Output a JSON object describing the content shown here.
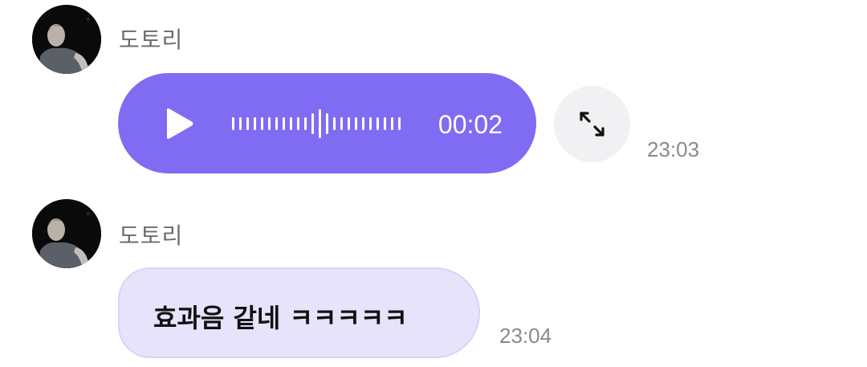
{
  "messages": [
    {
      "sender": "도토리",
      "type": "voice",
      "duration": "00:02",
      "time": "23:03",
      "icons": {
        "play": "play-icon",
        "expand": "expand-icon"
      }
    },
    {
      "sender": "도토리",
      "type": "text",
      "text": "효과음 같네 ㅋㅋㅋㅋㅋ",
      "time": "23:04"
    }
  ],
  "colors": {
    "voice_bubble": "#7f6cf3",
    "text_bubble": "#e6e3fb",
    "expand_button": "#f1f1f4",
    "timestamp": "#8a8a8a",
    "sender": "#6b6b6b"
  }
}
